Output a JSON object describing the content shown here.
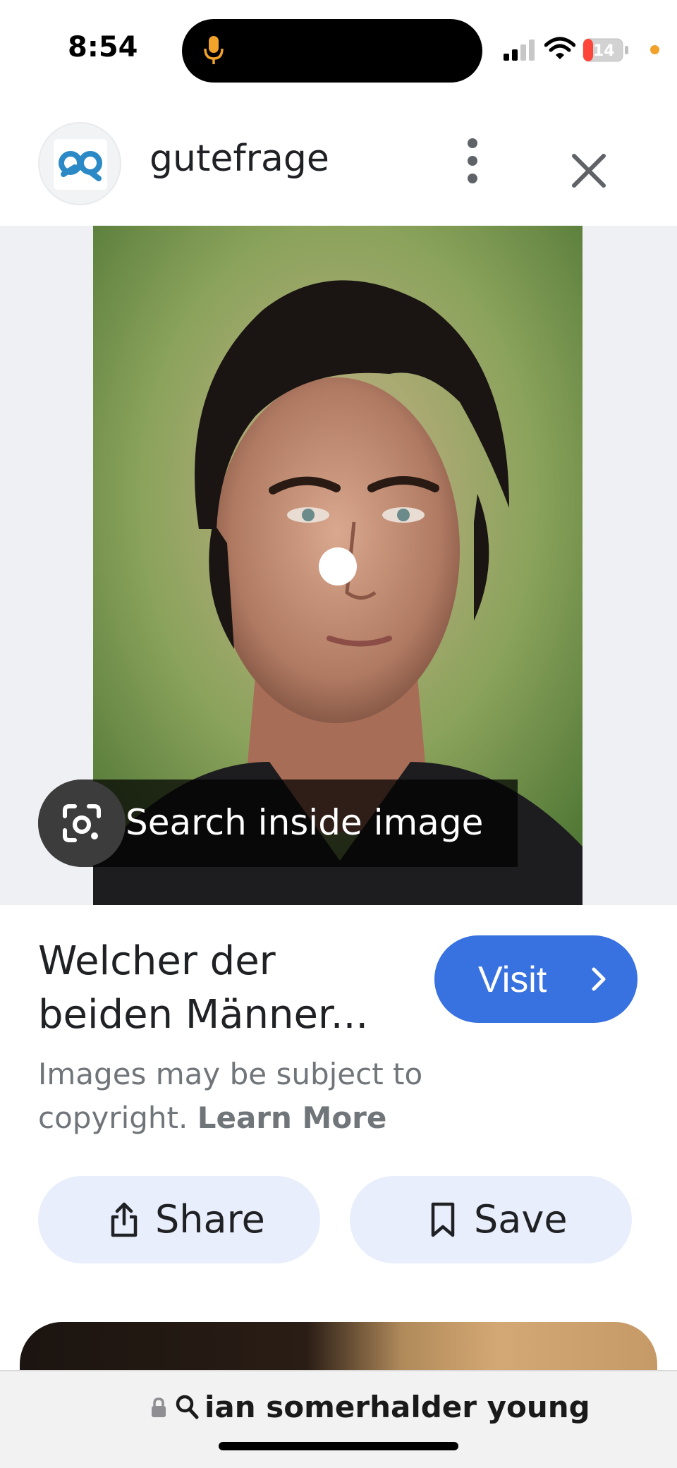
{
  "status_bar": {
    "time": "8:54",
    "battery_level": "14",
    "mic_indicator_color": "#f0a22b",
    "privacy_dot_color": "#f0a22b"
  },
  "header": {
    "site_name": "gutefrage",
    "logo_icon": "gutefrage-logo",
    "more_icon": "more-vertical-icon",
    "close_icon": "close-icon"
  },
  "image_viewer": {
    "search_inside_label": "Search inside image"
  },
  "result": {
    "title_line1": "Welcher der",
    "title_line2": "beiden Männer...",
    "visit_label": "Visit",
    "copyright_text": "Images may be subject to copyright.",
    "learn_more_label": "Learn More"
  },
  "actions": {
    "share_label": "Share",
    "save_label": "Save"
  },
  "address_bar": {
    "query": "ian somerhalder young"
  },
  "colors": {
    "accent_blue": "#3871e0",
    "action_button_bg": "#e8eefb"
  }
}
